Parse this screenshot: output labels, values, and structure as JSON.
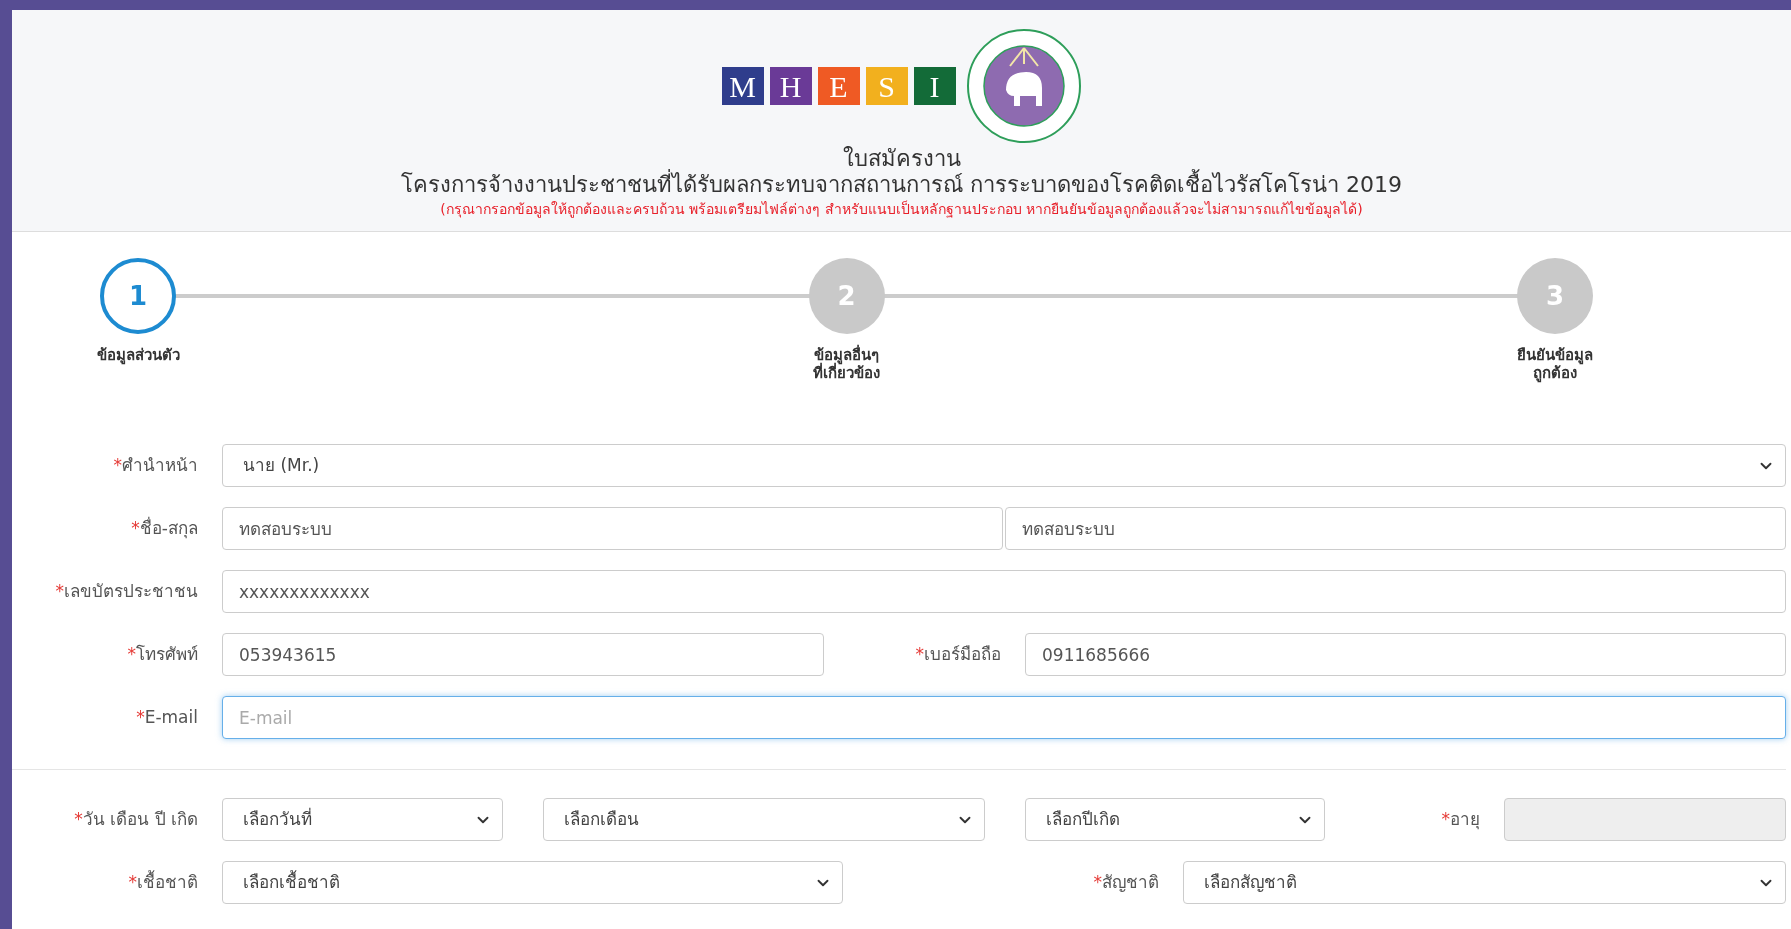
{
  "header": {
    "logo_letters": [
      {
        "letter": "M",
        "color": "#2f3d8c"
      },
      {
        "letter": "H",
        "color": "#6a3a97"
      },
      {
        "letter": "E",
        "color": "#ef5a24"
      },
      {
        "letter": "S",
        "color": "#f2b01e"
      },
      {
        "letter": "I",
        "color": "#136b38"
      }
    ],
    "title": "ใบสมัครงาน",
    "subtitle": "โครงการจ้างงานประชาชนที่ได้รับผลกระทบจากสถานการณ์ การระบาดของโรคติดเชื้อไวรัสโคโรน่า 2019",
    "notice": "(กรุณากรอกข้อมูลให้ถูกต้องและครบถ้วน พร้อมเตรียมไฟล์ต่างๆ สำหรับแนบเป็นหลักฐานประกอบ หากยืนยันข้อมูลถูกต้องแล้วจะไม่สามารถแก้ไขข้อมูลได้)"
  },
  "steps": [
    {
      "number": "1",
      "label": "ข้อมูลส่วนตัว",
      "selected": true
    },
    {
      "number": "2",
      "label": "ข้อมูลอื่นๆ\nที่เกี่ยวข้อง",
      "selected": false
    },
    {
      "number": "3",
      "label": "ยืนยันข้อมูล\nถูกต้อง",
      "selected": false
    }
  ],
  "form": {
    "rows": [
      {
        "fields": [
          {
            "kind": "label",
            "mark": "*",
            "text": "ศำนำหน้า"
          },
          {
            "kind": "select",
            "value": "นาย (Mr.)"
          }
        ]
      },
      {
        "fields": [
          {
            "kind": "label",
            "mark": "*",
            "text": "ชื่อ-สกุล"
          },
          {
            "kind": "text",
            "value": "ทดสอบระบบ",
            "focused": false
          },
          {
            "kind": "text",
            "value": "ทดสอบระบบ",
            "focused": false
          }
        ]
      },
      {
        "fields": [
          {
            "kind": "label",
            "mark": "*",
            "text": "เลขบัตรประชาชน"
          },
          {
            "kind": "text",
            "value": "xxxxxxxxxxxxx",
            "focused": false
          }
        ]
      },
      {
        "fields": [
          {
            "kind": "label",
            "mark": "*",
            "text": "โทรศัพท์"
          },
          {
            "kind": "text",
            "value": "053943615",
            "focused": false
          },
          {
            "kind": "label",
            "mark": "*",
            "text": "เบอร์มือถือ"
          },
          {
            "kind": "text",
            "value": "0911685666",
            "focused": false
          }
        ]
      },
      {
        "fields": [
          {
            "kind": "label",
            "mark": "*",
            "text": "E-mail"
          },
          {
            "kind": "text",
            "placeholder": "E-mail",
            "focused": true
          }
        ]
      },
      {
        "fields": [
          {
            "kind": "label",
            "mark": "*",
            "text": "วัน เดือน ปี เกิด"
          },
          {
            "kind": "select",
            "value": "เลือกวันที่"
          },
          {
            "kind": "select",
            "value": "เลือกเดือน"
          },
          {
            "kind": "select",
            "value": "เลือกปีเกิด"
          },
          {
            "kind": "label",
            "mark": "*",
            "text": "อายุ"
          },
          {
            "kind": "disabled"
          }
        ]
      },
      {
        "fields": [
          {
            "kind": "label",
            "mark": "*",
            "text": "เชื้อชาติ"
          },
          {
            "kind": "select",
            "value": "เลือกเชื้อชาติ"
          },
          {
            "kind": "label",
            "mark": "*",
            "text": "สัญชาติ"
          },
          {
            "kind": "select",
            "value": "เลือกสัญชาติ"
          }
        ]
      }
    ]
  }
}
